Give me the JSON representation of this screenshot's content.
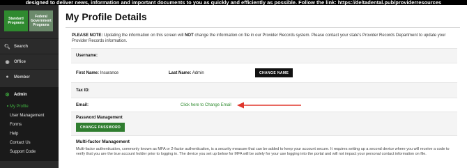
{
  "banner": {
    "text": "designed to deliver news, information and important documents to you as quickly and efficiently as possible. Follow the link: https://deltadental.pub/providerresources"
  },
  "sidebar": {
    "tabs": [
      {
        "label": "Standard Programs"
      },
      {
        "label": "Federal Government Programs"
      }
    ],
    "items": [
      {
        "label": "Search",
        "icon": "search-icon"
      },
      {
        "label": "Office",
        "icon": "office-icon"
      },
      {
        "label": "Member",
        "icon": "member-icon"
      },
      {
        "label": "Admin",
        "icon": "gear-icon"
      }
    ],
    "admin_sub": [
      "My Profile",
      "User Management",
      "Forms",
      "Help",
      "Contact Us",
      "Support Code"
    ]
  },
  "page": {
    "title": "My Profile Details",
    "notice_prefix": "PLEASE NOTE:",
    "notice_1": " Updating the information on this screen will ",
    "notice_not": "NOT",
    "notice_2": " change the information on file in our Provider Records system. Please contact your state's Provider Records Department to update your Provider Records information."
  },
  "profile": {
    "username_label": "Username:",
    "first_name_label": "First Name:",
    "first_name_value": "Insurance",
    "last_name_label": "Last Name:",
    "last_name_value": "Admin",
    "change_name_button": "CHANGE NAME",
    "tax_id_label": "Tax ID:",
    "email_label": "Email:",
    "change_email_link": "Click here to Change Email",
    "password_heading": "Password Management",
    "change_password_button": "CHANGE PASSWORD",
    "mfa_heading": "Multi-factor Management",
    "mfa_text": "Multi-factor authentication, commonly known as MFA or 2-factor authentication, is a security measure that can be added to keep your account secure. It requires setting up a second device where you will receive a code to verify that you are the true account holder prior to logging in. The device you set up below for MFA will be solely for your use logging into the portal and will not impact your personal contact information on file."
  },
  "colors": {
    "accent_green": "#2f8a2f",
    "arrow_red": "#e0362c"
  }
}
